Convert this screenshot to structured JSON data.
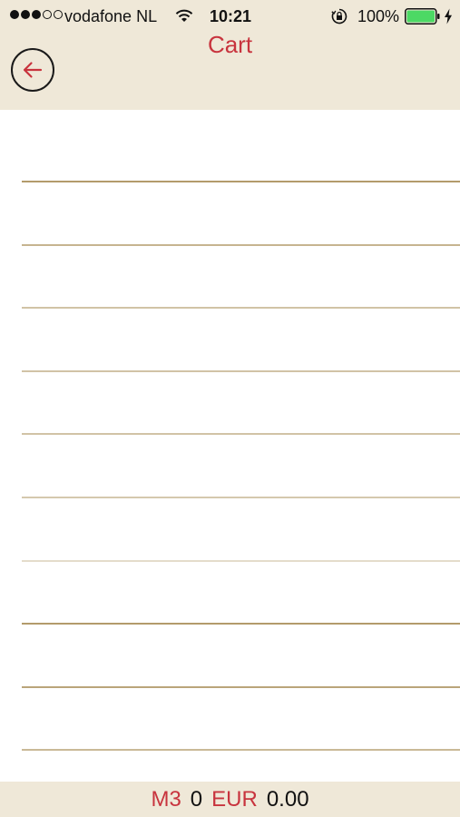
{
  "status_bar": {
    "carrier": "vodafone NL",
    "time": "10:21",
    "battery_percent": "100%",
    "signal_bars_filled": 3,
    "signal_bars_total": 5,
    "battery_level": 1.0,
    "battery_color": "#4cd964"
  },
  "nav": {
    "title": "Cart",
    "back_icon": "arrow-left-icon"
  },
  "cart": {
    "items": []
  },
  "footer": {
    "volume_unit": "M3",
    "volume_value": "0",
    "currency": "EUR",
    "total": "0.00"
  },
  "colors": {
    "accent": "#c8343e",
    "header_bg": "#efe8d8",
    "rule_line": "#b39b6b"
  }
}
